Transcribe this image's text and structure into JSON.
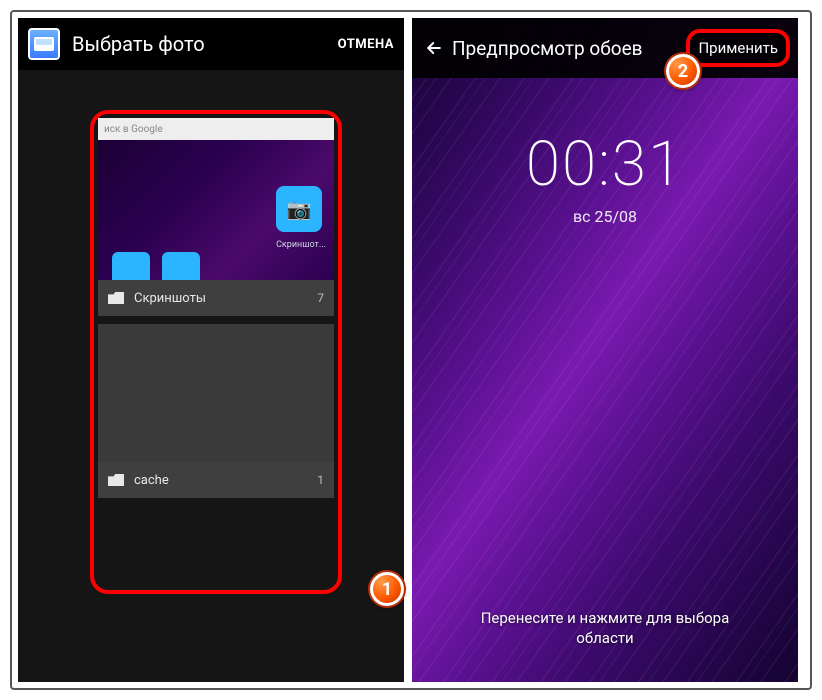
{
  "left": {
    "title": "Выбрать фото",
    "cancel": "ОТМЕНА",
    "search_placeholder": "иск в Google",
    "thumb_icon_label": "Скриншот...",
    "albums": [
      {
        "name": "Скриншоты",
        "count": "7"
      },
      {
        "name": "cache",
        "count": "1"
      }
    ]
  },
  "right": {
    "title": "Предпросмотр обоев",
    "apply": "Применить",
    "time": "00:31",
    "date": "вс 25/08",
    "instruction_l1": "Перенесите и нажмите для выбора",
    "instruction_l2": "области"
  },
  "badges": {
    "one": "1",
    "two": "2"
  }
}
